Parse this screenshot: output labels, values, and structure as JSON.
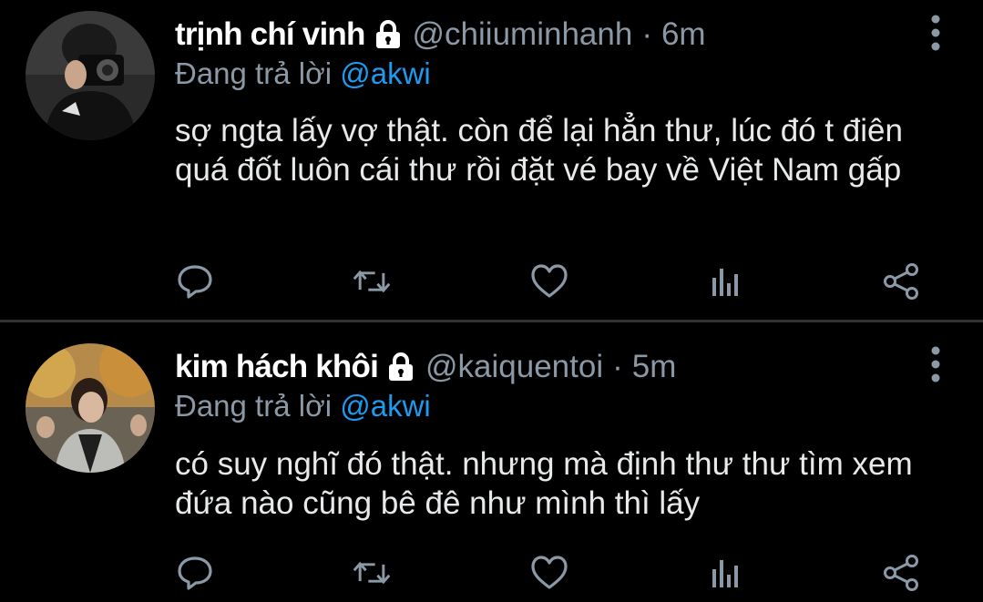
{
  "colors": {
    "background": "#000000",
    "text": "#e7e9ea",
    "muted": "#8b98a5",
    "accent": "#1d9bf0",
    "divider": "#2f3336"
  },
  "tweets": [
    {
      "display_name": "trịnh chí vinh",
      "handle": "@chiiuminhanh",
      "separator": "·",
      "time": "6m",
      "reply_prefix": "Đang trả lời",
      "reply_to": "@akwi",
      "text": "sợ ngta lấy vợ thật. còn để lại hẳn thư, lúc đó t điên quá đốt luôn cái thư rồi đặt vé bay về Việt Nam gấp",
      "icons": [
        "lock-icon",
        "more-icon",
        "reply-icon",
        "retweet-icon",
        "like-icon",
        "stats-icon",
        "share-icon"
      ]
    },
    {
      "display_name": "kim hách khôi",
      "handle": "@kaiquentoi",
      "separator": "·",
      "time": "5m",
      "reply_prefix": "Đang trả lời",
      "reply_to": "@akwi",
      "text": "có suy nghĩ đó thật. nhưng mà định thư thư tìm xem đứa nào cũng bê đê như mình thì lấy",
      "icons": [
        "lock-icon",
        "more-icon",
        "reply-icon",
        "retweet-icon",
        "like-icon",
        "stats-icon",
        "share-icon"
      ]
    }
  ]
}
